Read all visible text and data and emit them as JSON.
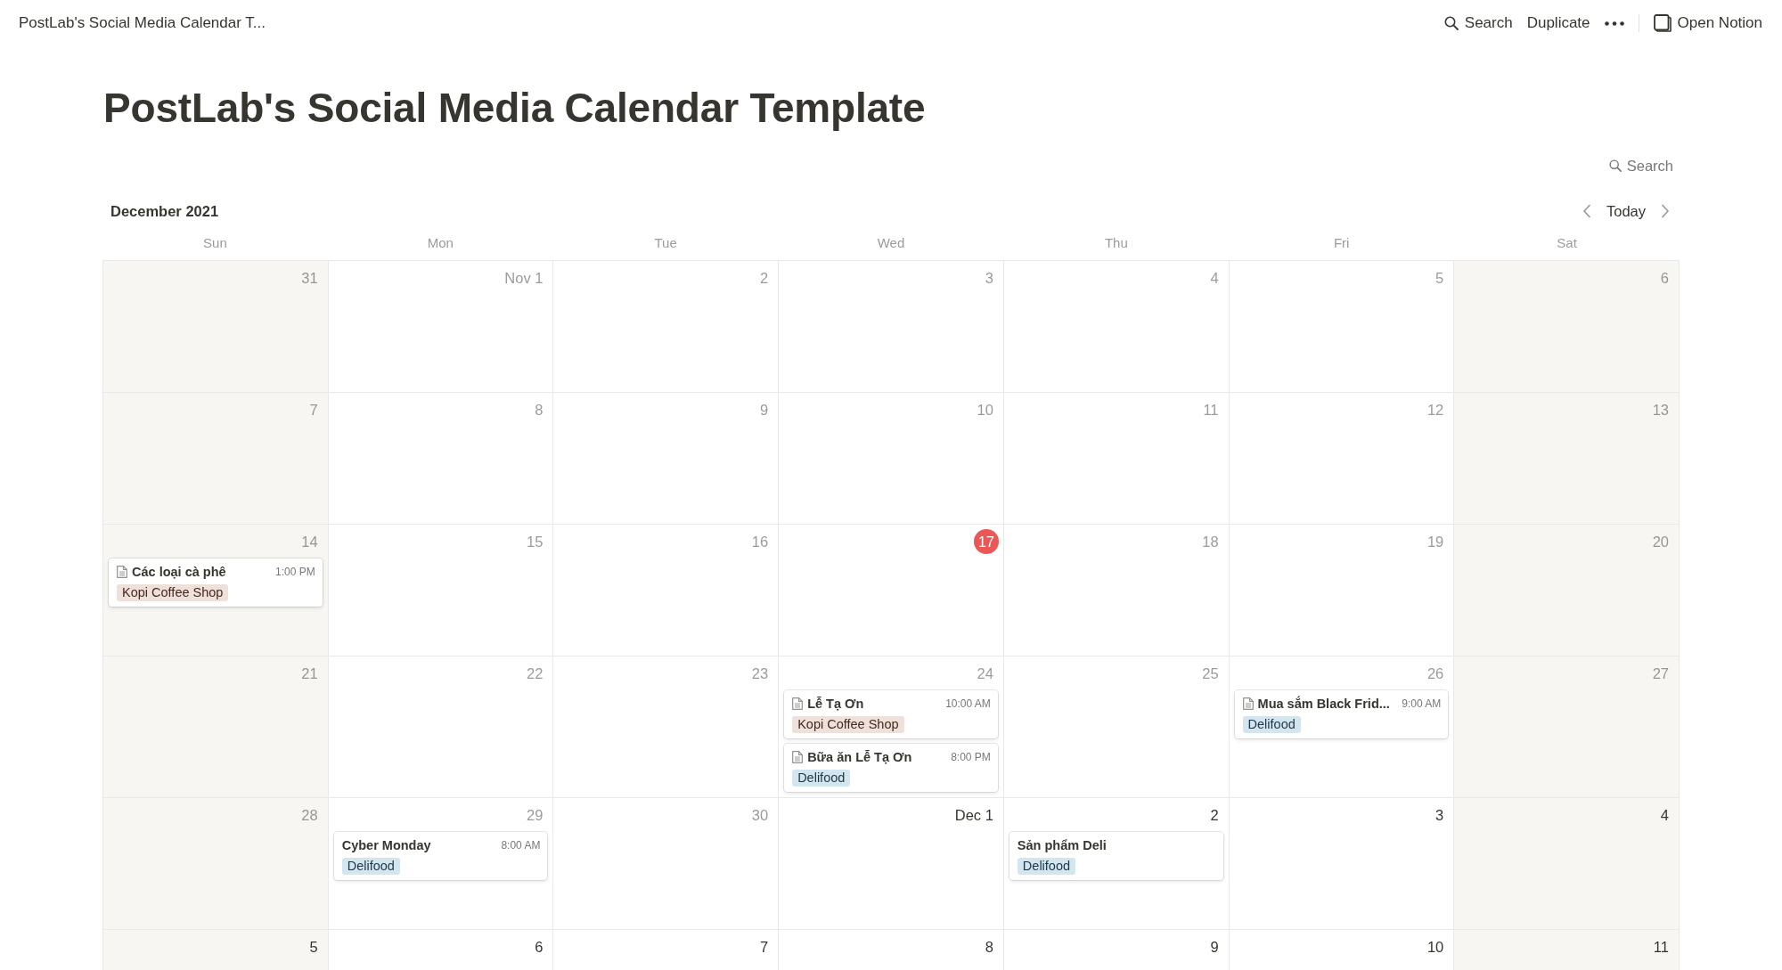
{
  "topbar": {
    "breadcrumb": "PostLab's Social Media Calendar T...",
    "actions": [
      {
        "kind": "search",
        "label": "Search"
      },
      {
        "kind": "duplicate",
        "label": "Duplicate"
      },
      {
        "kind": "more"
      },
      {
        "kind": "open_app",
        "label": "Open Notion"
      }
    ]
  },
  "page_title": "PostLab's Social Media Calendar Template",
  "calendar": {
    "search": "Search",
    "month": "December 2021",
    "today_button": "Today",
    "weekdays": [
      "Sun",
      "Mon",
      "Tue",
      "Wed",
      "Thu",
      "Fri",
      "Sat"
    ],
    "weeks": [
      {
        "days": [
          {
            "label": "31",
            "in_month": false,
            "today": false
          },
          {
            "label": "Nov 1",
            "in_month": false,
            "today": false
          },
          {
            "label": "2",
            "in_month": false,
            "today": false
          },
          {
            "label": "3",
            "in_month": false,
            "today": false
          },
          {
            "label": "4",
            "in_month": false,
            "today": false
          },
          {
            "label": "5",
            "in_month": false,
            "today": false
          },
          {
            "label": "6",
            "in_month": false,
            "today": false
          }
        ]
      },
      {
        "days": [
          {
            "label": "7",
            "in_month": false,
            "today": false
          },
          {
            "label": "8",
            "in_month": false,
            "today": false
          },
          {
            "label": "9",
            "in_month": false,
            "today": false
          },
          {
            "label": "10",
            "in_month": false,
            "today": false
          },
          {
            "label": "11",
            "in_month": false,
            "today": false
          },
          {
            "label": "12",
            "in_month": false,
            "today": false
          },
          {
            "label": "13",
            "in_month": false,
            "today": false
          }
        ]
      },
      {
        "days": [
          {
            "label": "14",
            "in_month": false,
            "today": false,
            "events": [
              {
                "title": "Các loại cà phê",
                "time": "1:00 PM",
                "page_icon": true,
                "tag": {
                  "label": "Kopi Coffee Shop",
                  "color": "#eee0da"
                }
              }
            ]
          },
          {
            "label": "15",
            "in_month": false,
            "today": false
          },
          {
            "label": "16",
            "in_month": false,
            "today": false
          },
          {
            "label": "17",
            "in_month": false,
            "today": true
          },
          {
            "label": "18",
            "in_month": false,
            "today": false
          },
          {
            "label": "19",
            "in_month": false,
            "today": false
          },
          {
            "label": "20",
            "in_month": false,
            "today": false
          }
        ]
      },
      {
        "days": [
          {
            "label": "21",
            "in_month": false,
            "today": false
          },
          {
            "label": "22",
            "in_month": false,
            "today": false
          },
          {
            "label": "23",
            "in_month": false,
            "today": false
          },
          {
            "label": "24",
            "in_month": false,
            "today": false,
            "events": [
              {
                "title": "Lễ Tạ Ơn",
                "time": "10:00 AM",
                "page_icon": true,
                "tag": {
                  "label": "Kopi Coffee Shop",
                  "color": "#eee0da"
                }
              },
              {
                "title": "Bữa ăn Lễ Tạ Ơn",
                "time": "8:00 PM",
                "page_icon": true,
                "tag": {
                  "label": "Delifood",
                  "color": "#d3e5ef"
                }
              }
            ]
          },
          {
            "label": "25",
            "in_month": false,
            "today": false
          },
          {
            "label": "26",
            "in_month": false,
            "today": false,
            "events": [
              {
                "title": "Mua sắm Black Frid...",
                "time": "9:00 AM",
                "page_icon": true,
                "tag": {
                  "label": "Delifood",
                  "color": "#d3e5ef"
                }
              }
            ]
          },
          {
            "label": "27",
            "in_month": false,
            "today": false
          }
        ]
      },
      {
        "days": [
          {
            "label": "28",
            "in_month": false,
            "today": false
          },
          {
            "label": "29",
            "in_month": false,
            "today": false,
            "events": [
              {
                "title": "Cyber Monday",
                "time": "8:00 AM",
                "page_icon": false,
                "tag": {
                  "label": "Delifood",
                  "color": "#d3e5ef"
                }
              }
            ]
          },
          {
            "label": "30",
            "in_month": false,
            "today": false
          },
          {
            "label": "Dec 1",
            "in_month": true,
            "today": false
          },
          {
            "label": "2",
            "in_month": true,
            "today": false,
            "events": [
              {
                "title": "Sản phẩm Deli",
                "page_icon": false,
                "tag": {
                  "label": "Delifood",
                  "color": "#d3e5ef"
                }
              }
            ]
          },
          {
            "label": "3",
            "in_month": true,
            "today": false
          },
          {
            "label": "4",
            "in_month": true,
            "today": false
          }
        ]
      },
      {
        "days": [
          {
            "label": "5",
            "in_month": true,
            "today": false
          },
          {
            "label": "6",
            "in_month": true,
            "today": false
          },
          {
            "label": "7",
            "in_month": true,
            "today": false
          },
          {
            "label": "8",
            "in_month": true,
            "today": false
          },
          {
            "label": "9",
            "in_month": true,
            "today": false
          },
          {
            "label": "10",
            "in_month": true,
            "today": false
          },
          {
            "label": "11",
            "in_month": true,
            "today": false
          }
        ]
      }
    ]
  }
}
